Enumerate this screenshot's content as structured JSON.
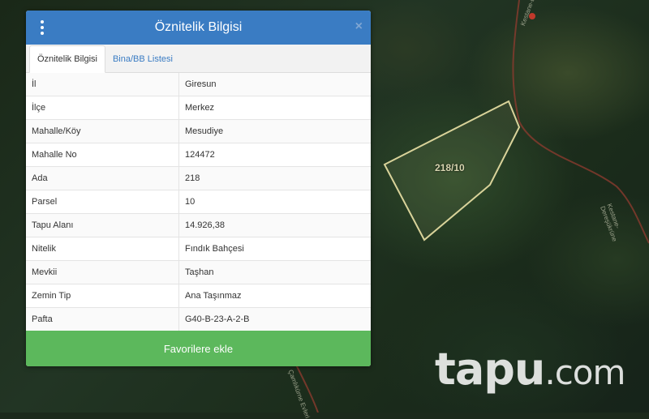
{
  "panel": {
    "title": "Öznitelik Bilgisi",
    "menu_icon": "vertical-ellipsis-icon",
    "close_icon": "close-icon",
    "close_glyph": "×"
  },
  "tabs": [
    {
      "label": "Öznitelik Bilgisi",
      "active": true
    },
    {
      "label": "Bina/BB Listesi",
      "active": false
    }
  ],
  "attributes": [
    {
      "key": "İl",
      "value": "Giresun"
    },
    {
      "key": "İlçe",
      "value": "Merkez"
    },
    {
      "key": "Mahalle/Köy",
      "value": "Mesudiye"
    },
    {
      "key": "Mahalle No",
      "value": "124472"
    },
    {
      "key": "Ada",
      "value": "218"
    },
    {
      "key": "Parsel",
      "value": "10"
    },
    {
      "key": "Tapu Alanı",
      "value": "14.926,38"
    },
    {
      "key": "Nitelik",
      "value": "Fındık Bahçesi"
    },
    {
      "key": "Mevkii",
      "value": "Taşhan"
    },
    {
      "key": "Zemin Tip",
      "value": "Ana Taşınmaz"
    },
    {
      "key": "Pafta",
      "value": "G40-B-23-A-2-B"
    }
  ],
  "favorite_button_label": "Favorilere ekle",
  "map": {
    "parcel_label": "218/10",
    "parcel_outline_color": "#d9d39a",
    "road_labels": [
      "Kestane-Dereşükrüne Evleri",
      "Kestane-Dereşükrüne",
      "Çamlıkürne Evleri"
    ]
  },
  "watermark": {
    "brand": "tapu",
    "suffix": ".com"
  }
}
